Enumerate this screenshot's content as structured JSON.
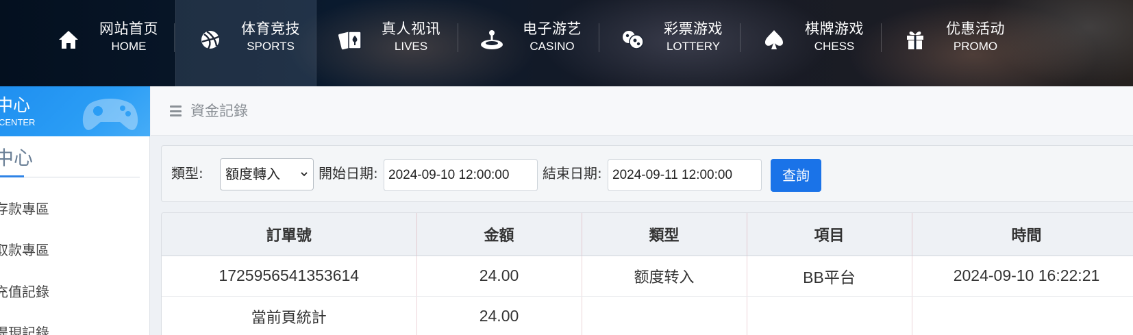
{
  "nav": {
    "items": [
      {
        "zh": "网站首页",
        "en": "HOME",
        "icon": "home-icon"
      },
      {
        "zh": "体育竞技",
        "en": "SPORTS",
        "icon": "ball-icon"
      },
      {
        "zh": "真人视讯",
        "en": "LIVES",
        "icon": "cards-icon"
      },
      {
        "zh": "电子游艺",
        "en": "CASINO",
        "icon": "joystick-icon"
      },
      {
        "zh": "彩票游戏",
        "en": "LOTTERY",
        "icon": "lottery-balls-icon"
      },
      {
        "zh": "棋牌游戏",
        "en": "CHESS",
        "icon": "spade-icon"
      },
      {
        "zh": "优惠活动",
        "en": "PROMO",
        "icon": "gift-icon"
      }
    ],
    "active_index": 1
  },
  "sidebar": {
    "title_zh": "中心",
    "title_en": "CENTER",
    "tab_label": "中心",
    "links": [
      "存款專區",
      "取款專區",
      "充值記錄",
      "提現記錄"
    ]
  },
  "page": {
    "title": "資金記錄"
  },
  "filter": {
    "type_label": "類型:",
    "type_value": "額度轉入",
    "start_label": "開始日期:",
    "start_value": "2024-09-10 12:00:00",
    "end_label": "結束日期:",
    "end_value": "2024-09-11 12:00:00",
    "query_label": "查詢"
  },
  "table": {
    "headers": [
      "訂單號",
      "金額",
      "類型",
      "項目",
      "時間"
    ],
    "rows": [
      [
        "1725956541353614",
        "24.00",
        "额度转入",
        "BB平台",
        "2024-09-10 16:22:21"
      ],
      [
        "當前頁統計",
        "24.00",
        "",
        "",
        ""
      ]
    ]
  },
  "colors": {
    "accent": "#1a73e8",
    "sidebar_header": "#2a9df5",
    "nav_bg": "#0a1a2e"
  }
}
